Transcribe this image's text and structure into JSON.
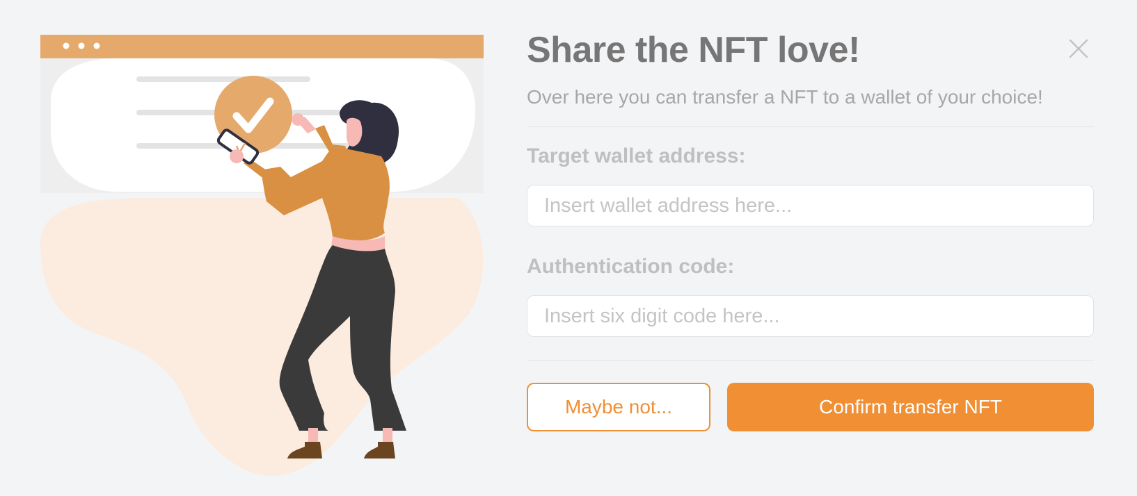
{
  "dialog": {
    "title": "Share the NFT love!",
    "subtitle": "Over here you can transfer a NFT to a wallet of your choice!",
    "close_icon": "close-icon"
  },
  "form": {
    "wallet": {
      "label": "Target wallet address:",
      "placeholder": "Insert wallet address here...",
      "value": ""
    },
    "code": {
      "label": "Authentication code:",
      "placeholder": "Insert six digit code here...",
      "value": ""
    }
  },
  "actions": {
    "cancel_label": "Maybe not...",
    "confirm_label": "Confirm transfer NFT"
  },
  "illustration": {
    "icon": "person-confirming-checkmark-illustration",
    "check_icon": "checkmark-icon"
  },
  "colors": {
    "accent": "#f08f34",
    "illustration_orange": "#e6a96c",
    "background": "#f3f4f6"
  }
}
